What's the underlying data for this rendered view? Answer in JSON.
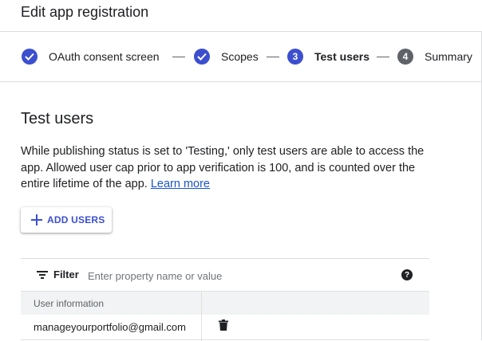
{
  "header": {
    "title": "Edit app registration"
  },
  "stepper": {
    "steps": [
      {
        "label": "OAuth consent screen",
        "state": "done"
      },
      {
        "label": "Scopes",
        "state": "done"
      },
      {
        "label": "Test users",
        "state": "active",
        "number": "3"
      },
      {
        "label": "Summary",
        "state": "todo",
        "number": "4"
      }
    ]
  },
  "section": {
    "title": "Test users",
    "description": "While publishing status is set to 'Testing,' only test users are able to access the app. Allowed user cap prior to app verification is 100, and is counted over the entire lifetime of the app.",
    "learn_more": "Learn more"
  },
  "add_button": {
    "label": "ADD USERS",
    "icon": "plus-icon"
  },
  "table": {
    "filter_label": "Filter",
    "filter_placeholder": "Enter property name or value",
    "help_icon": "help-icon",
    "columns": [
      "User information",
      ""
    ],
    "rows": [
      {
        "email": "manageyourportfolio@gmail.com",
        "action_icon": "delete-icon"
      }
    ]
  },
  "colors": {
    "accent": "#3c4fcf",
    "link": "#1a56c7",
    "header_bg": "#f1f3f4"
  }
}
